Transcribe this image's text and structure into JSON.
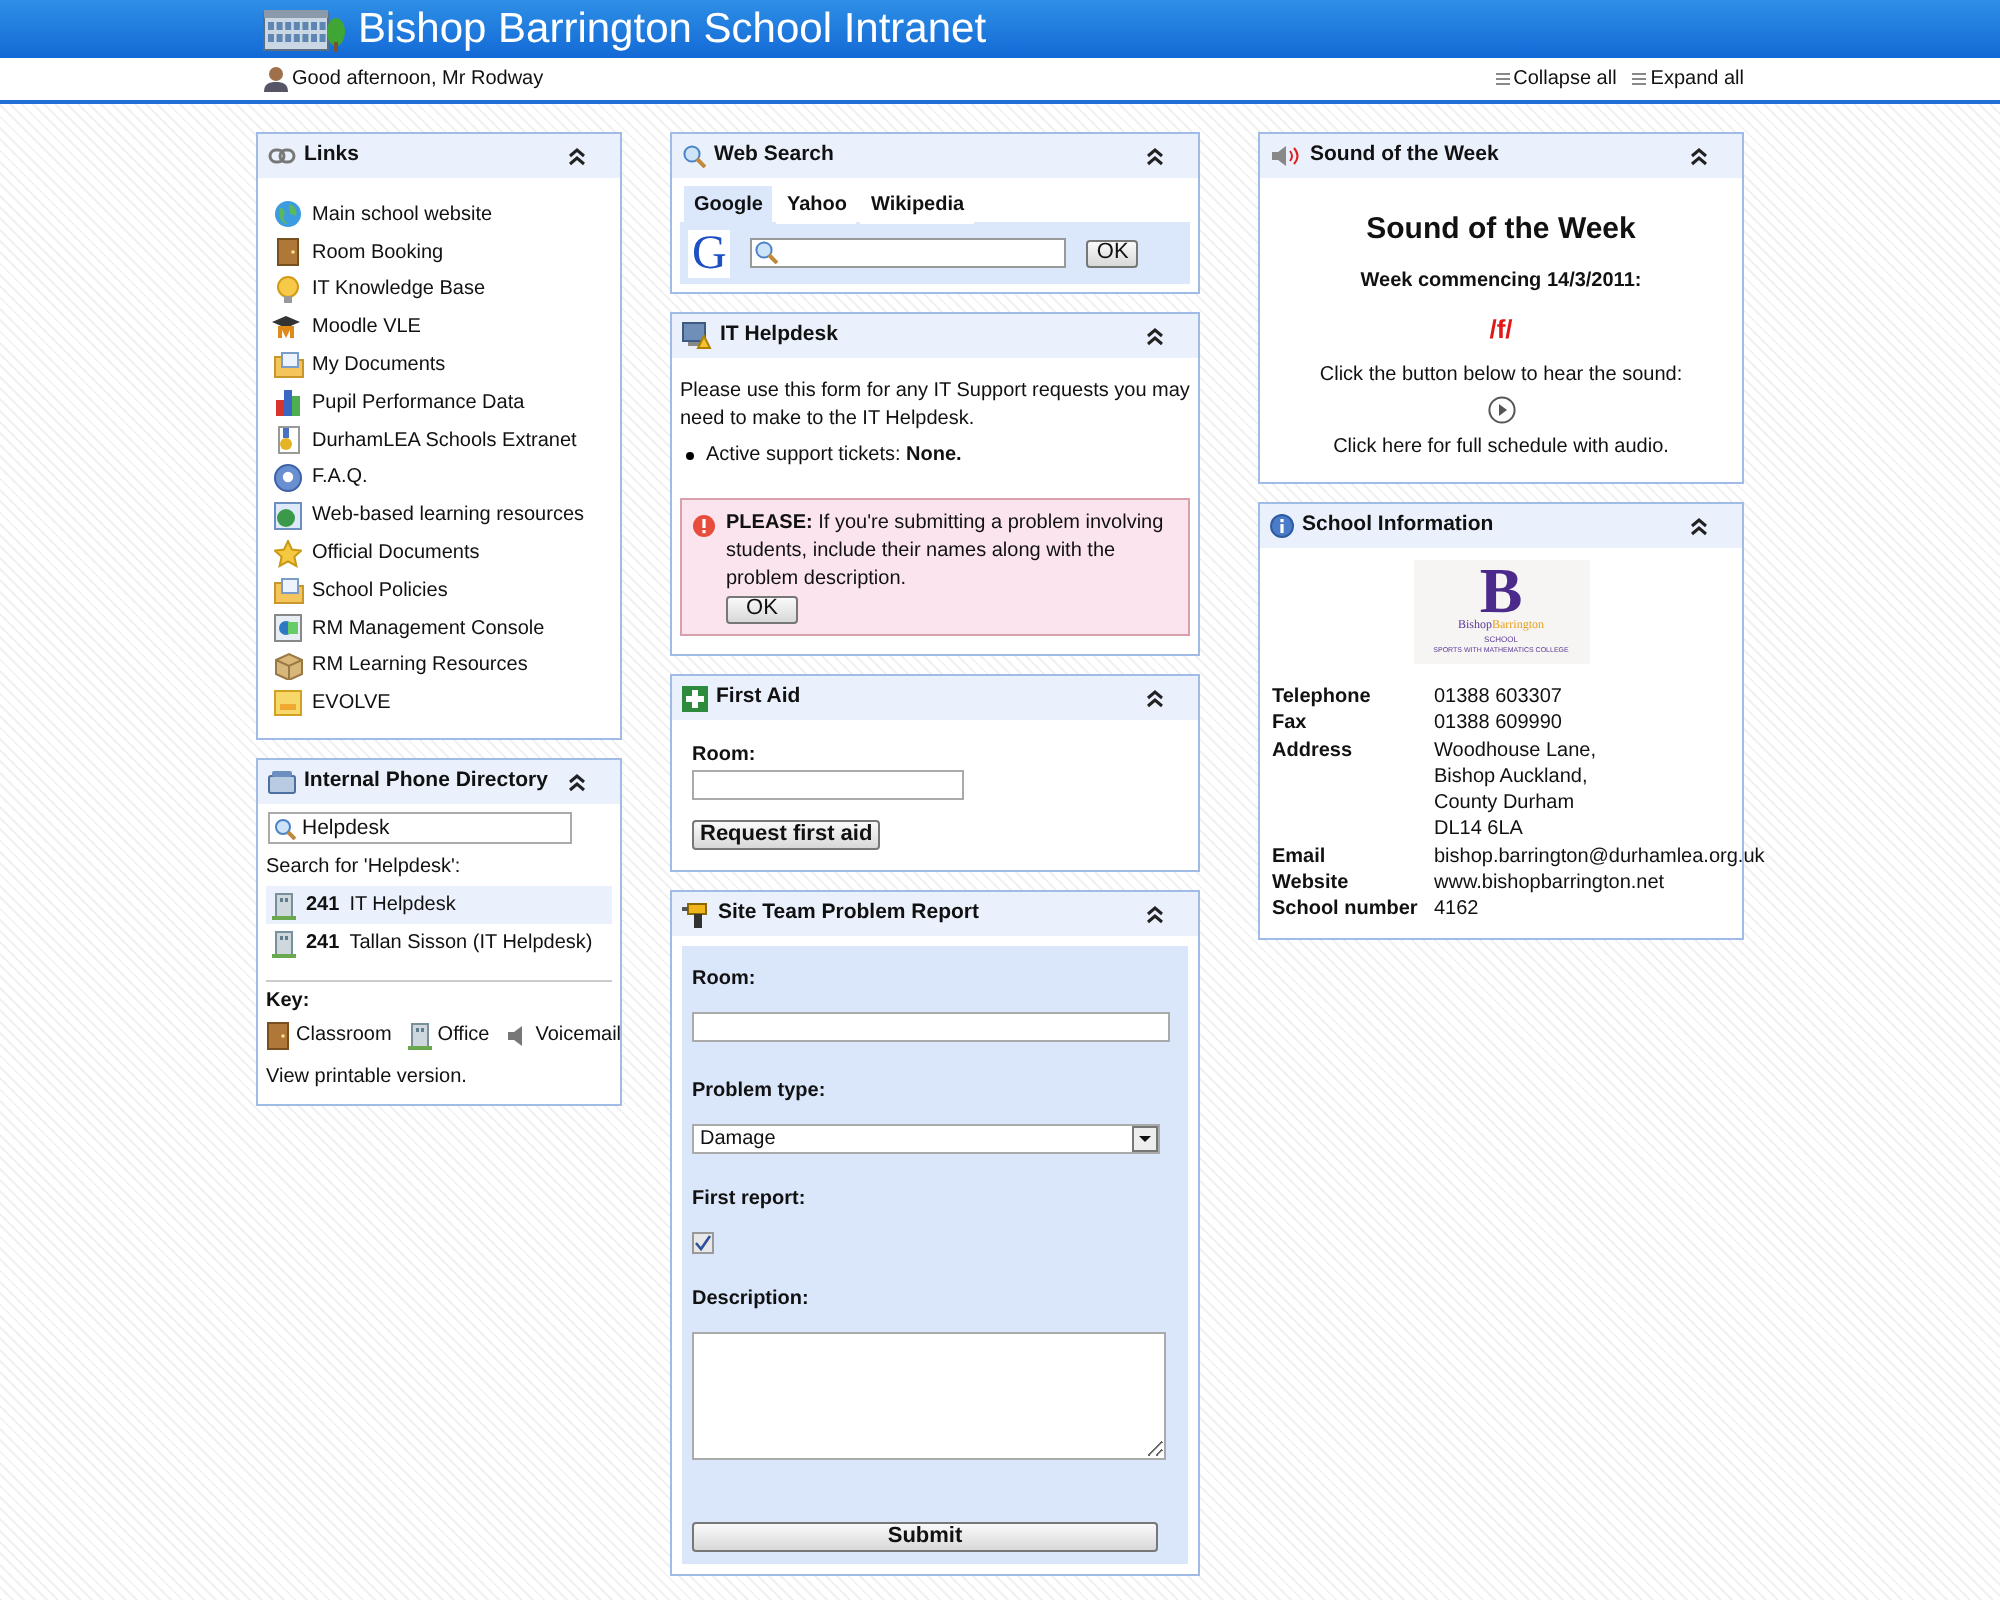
{
  "header": {
    "title": "Bishop Barrington School Intranet"
  },
  "toolbar": {
    "greeting": "Good afternoon, Mr Rodway",
    "actions": [
      "Collapse all",
      "Expand all"
    ]
  },
  "links": {
    "title": "Links",
    "expanded": true,
    "items": [
      {
        "label": "Main school website"
      },
      {
        "label": "Room Booking"
      },
      {
        "label": "IT Knowledge Base"
      },
      {
        "label": "Moodle VLE"
      },
      {
        "label": "My Documents"
      },
      {
        "label": "Pupil Performance Data"
      },
      {
        "label": "DurhamLEA Schools Extranet"
      },
      {
        "label": "F.A.Q."
      },
      {
        "label": "Web-based learning resources"
      },
      {
        "label": "Official Documents"
      },
      {
        "label": "School Policies"
      },
      {
        "label": "RM Management Console"
      },
      {
        "label": "RM Learning Resources"
      },
      {
        "label": "EVOLVE"
      }
    ]
  },
  "phone_directory": {
    "title": "Internal Phone Directory",
    "expanded": true,
    "search_value": "Helpdesk",
    "results_heading": "Search for 'Helpdesk':",
    "results": [
      {
        "number": "241",
        "name": "IT Helpdesk",
        "selected": true
      },
      {
        "number": "241",
        "name": "Tallan Sisson (IT Helpdesk)",
        "selected": false
      }
    ],
    "key_heading": "Key:",
    "key": [
      {
        "kind": "classroom",
        "label": "Classroom"
      },
      {
        "kind": "office",
        "label": "Office"
      },
      {
        "kind": "voicemail",
        "label": "Voicemail"
      }
    ],
    "printable_link": "View printable version."
  },
  "web_search": {
    "title": "Web Search",
    "expanded": true,
    "tabs": [
      {
        "label": "Google",
        "selected": true
      },
      {
        "label": "Yahoo",
        "selected": false
      },
      {
        "label": "Wikipedia",
        "selected": false
      }
    ],
    "engine_logo": "G",
    "button": "OK"
  },
  "it_helpdesk": {
    "title": "IT Helpdesk",
    "expanded": true,
    "intro": "Please use this form for any IT Support requests you may need to make to the IT Helpdesk.",
    "tickets": "Active support tickets: **None.**",
    "alert": "**PLEASE:** If you're submitting a problem involving students, include their names along with the problem description.",
    "alert_button": "OK"
  },
  "first_aid": {
    "title": "First Aid",
    "expanded": true,
    "room_label": "Room:",
    "button": "Request first aid"
  },
  "site_team": {
    "title": "Site Team Problem Report",
    "expanded": true,
    "room_label": "Room:",
    "problem_type_label": "Problem type:",
    "problem_type": "Damage",
    "first_report_label": "First report:",
    "first_report": true,
    "description_label": "Description:",
    "button": "Submit"
  },
  "sound_of_week": {
    "title": "Sound of the Week",
    "expanded": true,
    "heading": "Sound of the Week",
    "week": "Week commencing 14/3/2011:",
    "sound": "/f/",
    "instruction": "Click the button below to hear the sound:",
    "schedule_link": "Click here for full schedule with audio."
  },
  "school_info": {
    "title": "School Information",
    "expanded": true,
    "logo": {
      "letter": "B",
      "name_first": "Bishop",
      "name_second": "Barrington",
      "school": "SCHOOL",
      "tagline": "SPORTS WITH MATHEMATICS COLLEGE"
    },
    "details": [
      {
        "label": "Telephone",
        "value": "01388 603307"
      },
      {
        "label": "Fax",
        "value": "01388 609990"
      },
      {
        "label": "Address",
        "value": "Woodhouse Lane,\nBishop Auckland,\nCounty Durham\nDL14 6LA"
      },
      {
        "label": "Email",
        "value": "bishop.barrington@durhamlea.org.uk"
      },
      {
        "label": "Website",
        "value": "www.bishopbarrington.net"
      },
      {
        "label": "School number",
        "value": "4162"
      }
    ]
  }
}
